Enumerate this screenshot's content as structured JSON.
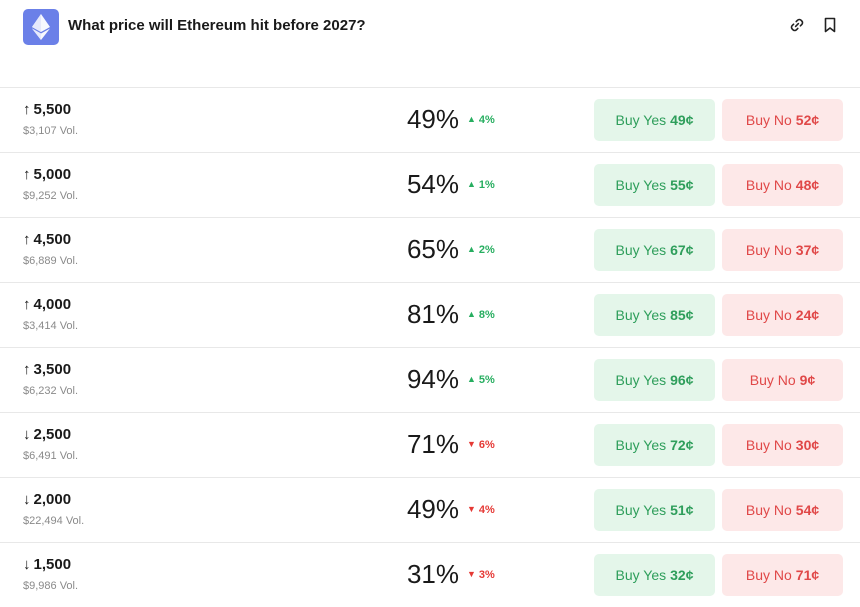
{
  "header": {
    "title": "What price will Ethereum hit before 2027?",
    "logo_icon": "ethereum-icon",
    "actions": [
      "link-icon",
      "bookmark-icon"
    ]
  },
  "colors": {
    "logo_bg": "#6b80e8",
    "up": "#27ae60",
    "down": "#e53935",
    "yes_bg": "#e4f6ea",
    "yes_text": "#2e9e5b",
    "no_bg": "#fde8e8",
    "no_text": "#e04848"
  },
  "rows": [
    {
      "arrow": "↑",
      "label": "5,500",
      "volume": "$3,107 Vol.",
      "percent": "49%",
      "direction": "up",
      "change": "4%",
      "yes_label": "Buy Yes",
      "yes_price": "49¢",
      "no_label": "Buy No",
      "no_price": "52¢"
    },
    {
      "arrow": "↑",
      "label": "5,000",
      "volume": "$9,252 Vol.",
      "percent": "54%",
      "direction": "up",
      "change": "1%",
      "yes_label": "Buy Yes",
      "yes_price": "55¢",
      "no_label": "Buy No",
      "no_price": "48¢"
    },
    {
      "arrow": "↑",
      "label": "4,500",
      "volume": "$6,889 Vol.",
      "percent": "65%",
      "direction": "up",
      "change": "2%",
      "yes_label": "Buy Yes",
      "yes_price": "67¢",
      "no_label": "Buy No",
      "no_price": "37¢"
    },
    {
      "arrow": "↑",
      "label": "4,000",
      "volume": "$3,414 Vol.",
      "percent": "81%",
      "direction": "up",
      "change": "8%",
      "yes_label": "Buy Yes",
      "yes_price": "85¢",
      "no_label": "Buy No",
      "no_price": "24¢"
    },
    {
      "arrow": "↑",
      "label": "3,500",
      "volume": "$6,232 Vol.",
      "percent": "94%",
      "direction": "up",
      "change": "5%",
      "yes_label": "Buy Yes",
      "yes_price": "96¢",
      "no_label": "Buy No",
      "no_price": "9¢"
    },
    {
      "arrow": "↓",
      "label": "2,500",
      "volume": "$6,491 Vol.",
      "percent": "71%",
      "direction": "down",
      "change": "6%",
      "yes_label": "Buy Yes",
      "yes_price": "72¢",
      "no_label": "Buy No",
      "no_price": "30¢"
    },
    {
      "arrow": "↓",
      "label": "2,000",
      "volume": "$22,494 Vol.",
      "percent": "49%",
      "direction": "down",
      "change": "4%",
      "yes_label": "Buy Yes",
      "yes_price": "51¢",
      "no_label": "Buy No",
      "no_price": "54¢"
    },
    {
      "arrow": "↓",
      "label": "1,500",
      "volume": "$9,986 Vol.",
      "percent": "31%",
      "direction": "down",
      "change": "3%",
      "yes_label": "Buy Yes",
      "yes_price": "32¢",
      "no_label": "Buy No",
      "no_price": "71¢"
    }
  ]
}
